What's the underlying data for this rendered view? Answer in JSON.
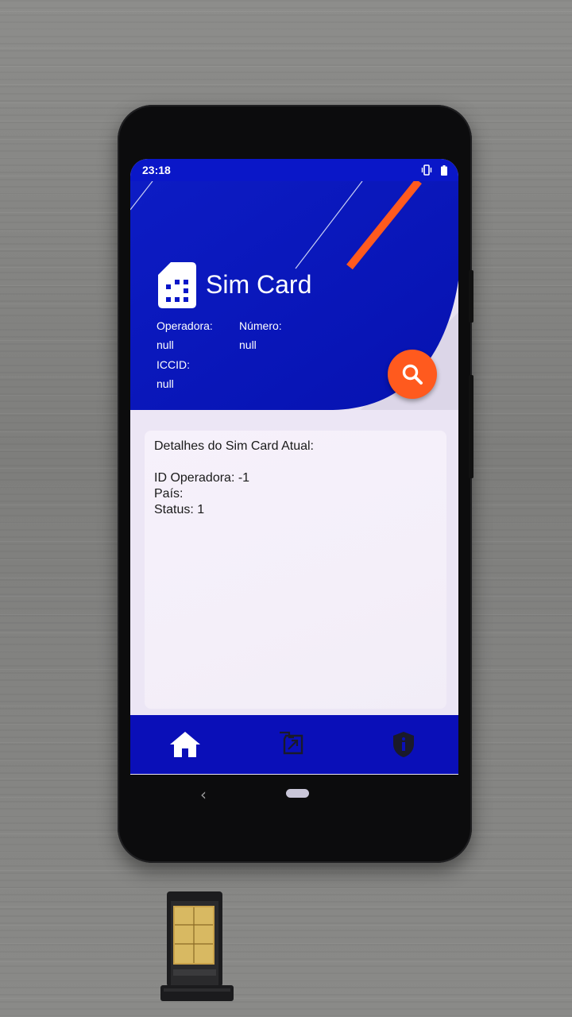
{
  "status_bar": {
    "time": "23:18",
    "icons": [
      "vibrate-icon",
      "battery-icon"
    ]
  },
  "header": {
    "title": "Sim Card",
    "icon": "sim-card-icon",
    "operadora_label": "Operadora:",
    "operadora_value": "null",
    "numero_label": "Número:",
    "numero_value": "null",
    "iccid_label": "ICCID:",
    "iccid_value": "null",
    "search_icon": "search-icon"
  },
  "details": {
    "title": "Detalhes do Sim Card Atual:",
    "id_operadora": "ID Operadora: -1",
    "pais": "País:",
    "status": "Status: 1"
  },
  "bottom_nav": {
    "items": [
      "home-icon",
      "sim-swap-icon",
      "shield-info-icon"
    ]
  },
  "colors": {
    "primary": "#0a17c8",
    "accent": "#ff5a1e",
    "card": "#f5f0fa",
    "background": "#ece6f5"
  }
}
